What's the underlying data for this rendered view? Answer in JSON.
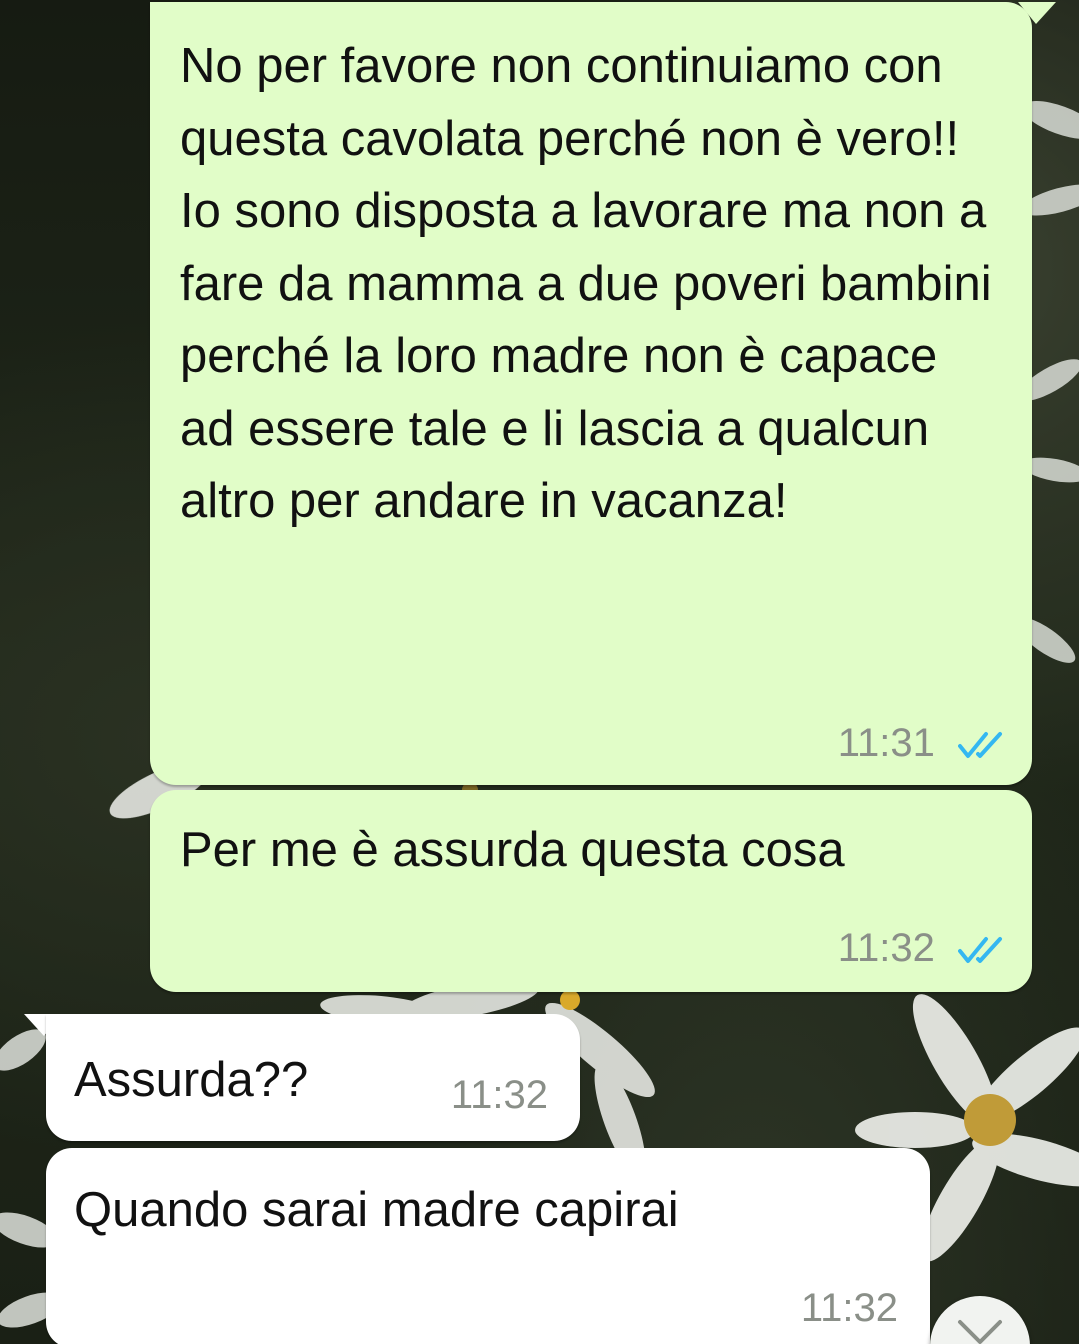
{
  "messages": [
    {
      "direction": "outgoing",
      "text": "No per favore non continuiamo con questa cavolata perché non è vero!! Io sono disposta a lavorare ma non a fare da mamma a due poveri bambini perché la loro madre non è capace ad essere tale e li lascia a qualcun altro per andare in vacanza!",
      "time": "11:31",
      "status": "read"
    },
    {
      "direction": "outgoing",
      "text": "Per me è assurda questa cosa",
      "time": "11:32",
      "status": "read"
    },
    {
      "direction": "incoming",
      "text": "Assurda??",
      "time": "11:32"
    },
    {
      "direction": "incoming",
      "text": "Quando sarai madre capirai",
      "time": "11:32"
    }
  ],
  "icons": {
    "read_receipt": "double-check-icon",
    "scroll_down": "chevron-down-icon"
  },
  "colors": {
    "outgoing_bubble": "#e1fdc8",
    "incoming_bubble": "#ffffff",
    "read_check": "#34b7f1",
    "timestamp": "#8a8f88"
  }
}
